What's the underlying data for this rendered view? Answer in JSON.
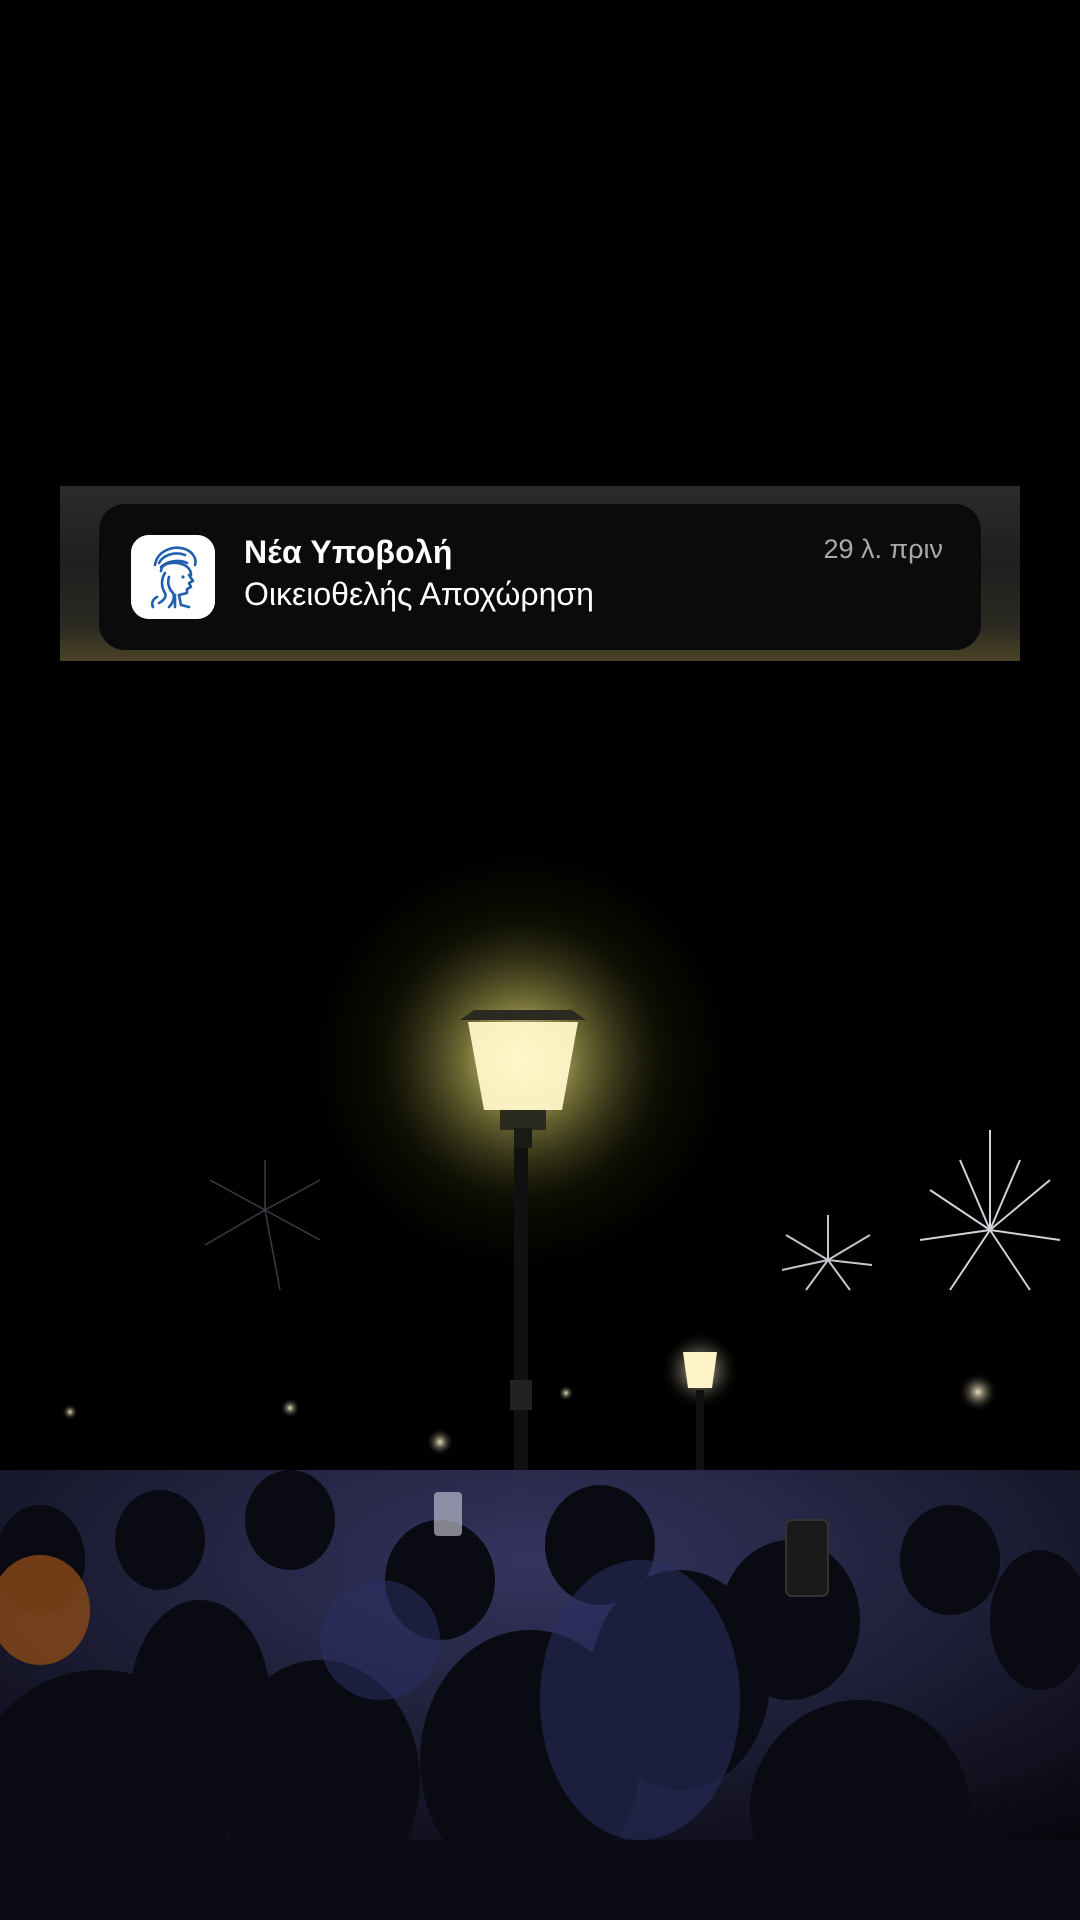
{
  "notification": {
    "app_icon": "athena-helmet-icon",
    "title": "Νέα Υποβολή",
    "body": "Οικειοθελής Αποχώρηση",
    "time": "29 λ. πριν"
  },
  "wallpaper": {
    "description_icon": "night-crowd-photo",
    "accent_color": "#fff3b0"
  }
}
